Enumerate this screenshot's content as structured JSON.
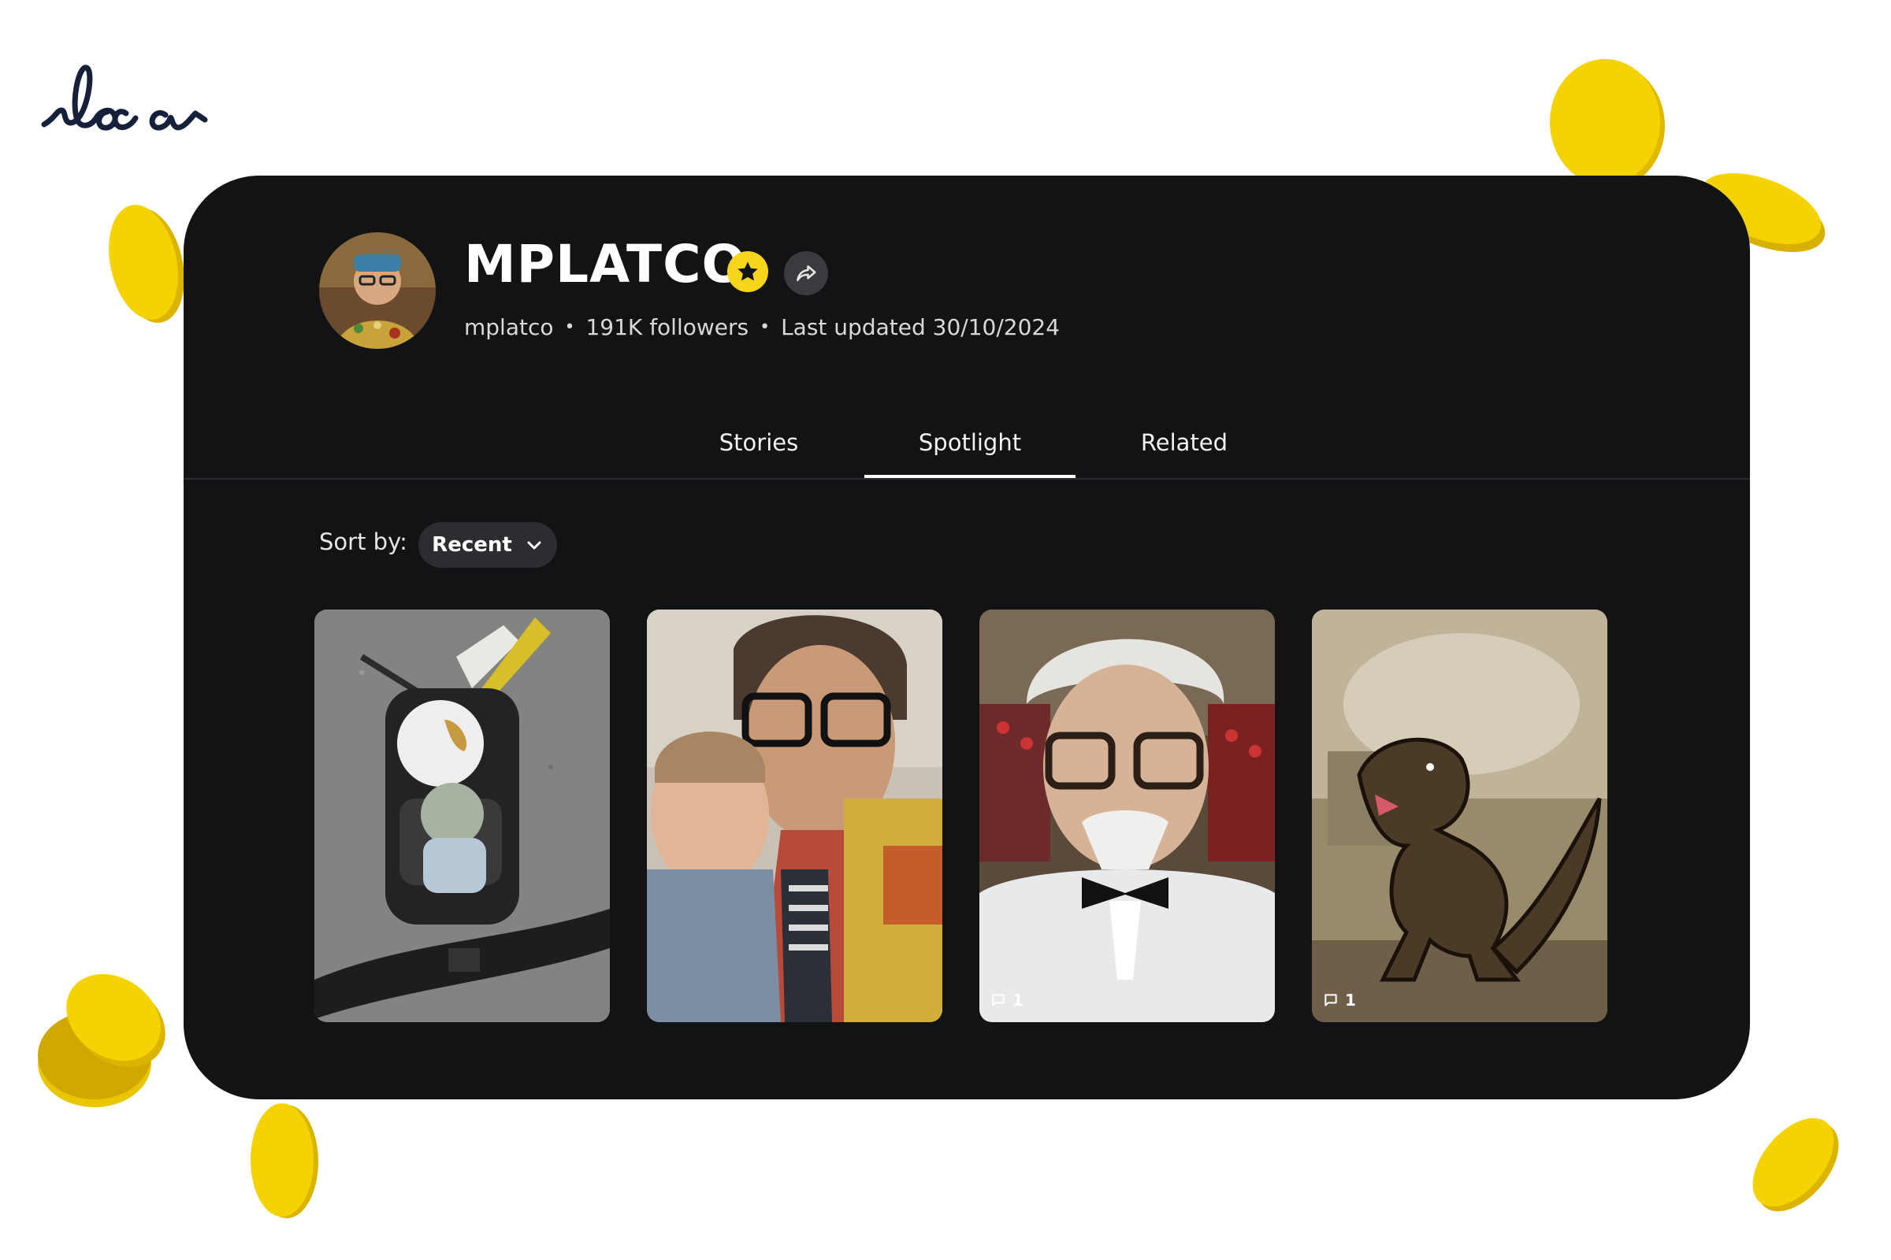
{
  "brand": {
    "logo_text": "loca"
  },
  "profile": {
    "name": "MPLATCO",
    "username": "mplatco",
    "followers": "191K followers",
    "last_updated": "Last updated 30/10/2024",
    "badge_icon": "star-icon",
    "share_icon": "share-icon"
  },
  "tabs": [
    {
      "label": "Stories",
      "active": false
    },
    {
      "label": "Spotlight",
      "active": true
    },
    {
      "label": "Related",
      "active": false
    }
  ],
  "sort": {
    "label": "Sort by:",
    "value": "Recent"
  },
  "thumbnails": [
    {
      "subject": "stroller-with-child",
      "comments": ""
    },
    {
      "subject": "man-with-toddler",
      "comments": ""
    },
    {
      "subject": "colonel-costume",
      "comments": "1"
    },
    {
      "subject": "dinosaur-drawing",
      "comments": "1"
    }
  ],
  "colors": {
    "card": "#121314",
    "accent": "#f7d51d",
    "coin": "#f5d300"
  }
}
